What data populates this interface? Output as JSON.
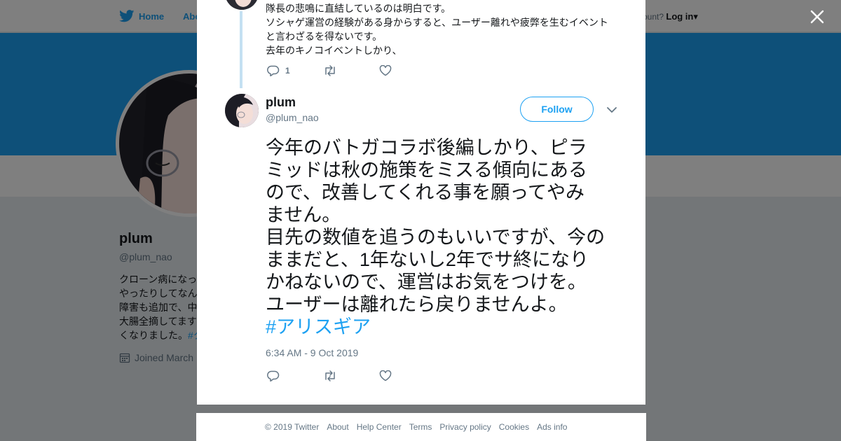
{
  "nav": {
    "home_label": "Home",
    "about_label": "Abo",
    "account_prompt": "ccount?",
    "login_label": "Log in"
  },
  "profile": {
    "name": "plum",
    "handle": "@plum_nao",
    "bio_lines": [
      "クローン病になっ",
      "やったりしてなん",
      "障害も追加で、中",
      "大腸全摘してます"
    ],
    "bio_last_prefix": "くなりました。",
    "bio_hashtag": "#ク",
    "joined": "Joined March"
  },
  "modal": {
    "prev_tweet_lines": [
      "隊長の悲鳴に直結しているのは明白です。",
      "ソシャゲ運営の経験がある身からすると、ユーザー離れや疲弊を生むイベント",
      "と言わざるを得ないです。",
      "去年のキノコイベントしかり、"
    ],
    "prev_reply_count": "1",
    "author_name": "plum",
    "author_handle": "@plum_nao",
    "follow_label": "Follow",
    "tweet_lines": [
      "今年のバトガコラボ後編しかり、ピラ",
      "ミッドは秋の施策をミスる傾向にある",
      "ので、改善してくれる事を願ってやみ",
      "ません。",
      "目先の数値を追うのもいいですが、今の",
      "ままだと、1年ないし2年でサ終になり",
      "かねないので、運営はお気をつけを。",
      "ユーザーは離れたら戻りませんよ。"
    ],
    "tweet_hashtag": "#アリスギア",
    "timestamp": "6:34 AM - 9 Oct 2019"
  },
  "footer": {
    "copyright": "© 2019 Twitter",
    "links": [
      "About",
      "Help Center",
      "Terms",
      "Privacy policy",
      "Cookies",
      "Ads info"
    ]
  },
  "icons": {
    "brand": "twitter-bird-icon",
    "close": "close-icon",
    "reply": "reply-icon",
    "retweet": "retweet-icon",
    "like": "heart-icon",
    "more": "chevron-down-icon",
    "calendar": "calendar-icon"
  },
  "colors": {
    "accent": "#1da1f2",
    "text": "#14171a",
    "secondary": "#657786"
  }
}
